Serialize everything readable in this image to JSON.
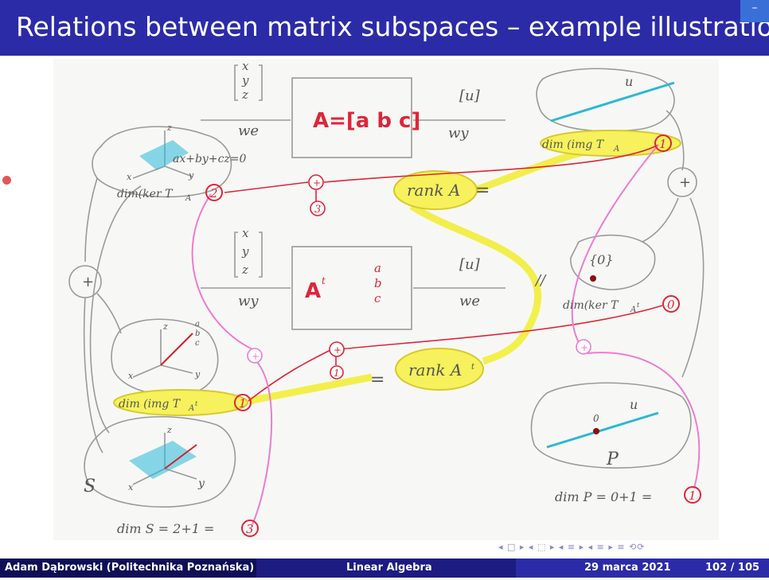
{
  "slide": {
    "title": "Relations between matrix subspaces – example illustration",
    "corner_button": "–"
  },
  "figure": {
    "vec_in": [
      "x",
      "y",
      "z"
    ],
    "u_box": "[u]",
    "we": "we",
    "wy": "wy",
    "matrix_A": "A=[a b c]",
    "matrix_At_letter": "A",
    "matrix_At_sup": "t",
    "col": [
      "a",
      "b",
      "c"
    ],
    "plane_eq": "ax+by+cz=0",
    "dim_ker_A": "dim(ker T",
    "sub_A": "A",
    "sub_At": "A",
    "sup_t": "t",
    "dim_img_A": "dim (img T",
    "dim_img_At": "dim (img T",
    "dim_ker_At": "dim(ker T",
    "rank_A": "rank A",
    "rank_At": "rank A",
    "zero_set": "{0}",
    "num_2": "2",
    "num_1": "1",
    "num_0": "0",
    "num_3": "3",
    "sum_3": "3",
    "sum_1": "1",
    "plus": "+",
    "S": "S",
    "P": "P",
    "u": "u",
    "origin": "0",
    "dim_S": "dim S = 2+1 =",
    "dim_P": "dim P = 0+1 =",
    "axis_x": "x",
    "axis_y": "y",
    "axis_z": "z",
    "eq_sign": "=",
    "parallel": "//"
  },
  "nav": {
    "symbols": "◂ □ ▸ ◂ ⬚ ▸ ◂ ≡ ▸ ◂ ≡ ▸   ≡   ⟲⟳"
  },
  "footer": {
    "author": "Adam Dąbrowski  (Politechnika Poznańska)",
    "course": "Linear Algebra",
    "date": "29 marca 2021",
    "page": "102 / 105"
  },
  "colors": {
    "title_bg": "#2b2ba8",
    "red": "#e0243a",
    "pink": "#f07ad2",
    "yellow": "#f2ee3a",
    "cyan": "#2ab8d8"
  }
}
